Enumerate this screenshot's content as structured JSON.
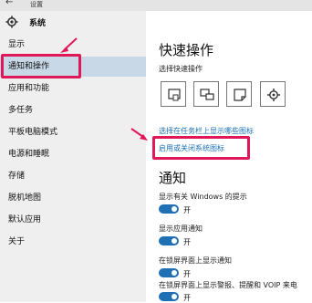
{
  "window": {
    "title": "设置",
    "back_icon": "back-arrow-icon"
  },
  "sidebar": {
    "header": {
      "label": "系统",
      "icon": "gear-icon"
    },
    "items": [
      {
        "label": "显示"
      },
      {
        "label": "通知和操作",
        "selected": true
      },
      {
        "label": "应用和功能"
      },
      {
        "label": "多任务"
      },
      {
        "label": "平板电脑模式"
      },
      {
        "label": "电源和睡眠"
      },
      {
        "label": "存储"
      },
      {
        "label": "脱机地图"
      },
      {
        "label": "默认应用"
      },
      {
        "label": "关于"
      }
    ]
  },
  "quick_actions": {
    "title": "快速操作",
    "subtitle": "选择快速操作",
    "tiles": [
      "tablet-mode-icon",
      "connect-display-icon",
      "note-icon",
      "settings-icon"
    ],
    "link_taskbar_icons": "选择在任务栏上显示哪些图标",
    "link_system_icons": "启用或关闭系统图标"
  },
  "notifications": {
    "title": "通知",
    "settings": [
      {
        "label": "显示有关 Windows 的提示",
        "state": "开"
      },
      {
        "label": "显示应用通知",
        "state": "开"
      },
      {
        "label": "在锁屏界面上显示通知",
        "state": "开"
      },
      {
        "label": "在锁屏界面上显示警报、提醒和 VOIP 来电",
        "state": "开"
      }
    ]
  },
  "colors": {
    "accent": "#1f6fb5",
    "highlight": "#e0185a",
    "selected_bg": "#c8d8e6",
    "sidebar_bg": "#efefef"
  }
}
